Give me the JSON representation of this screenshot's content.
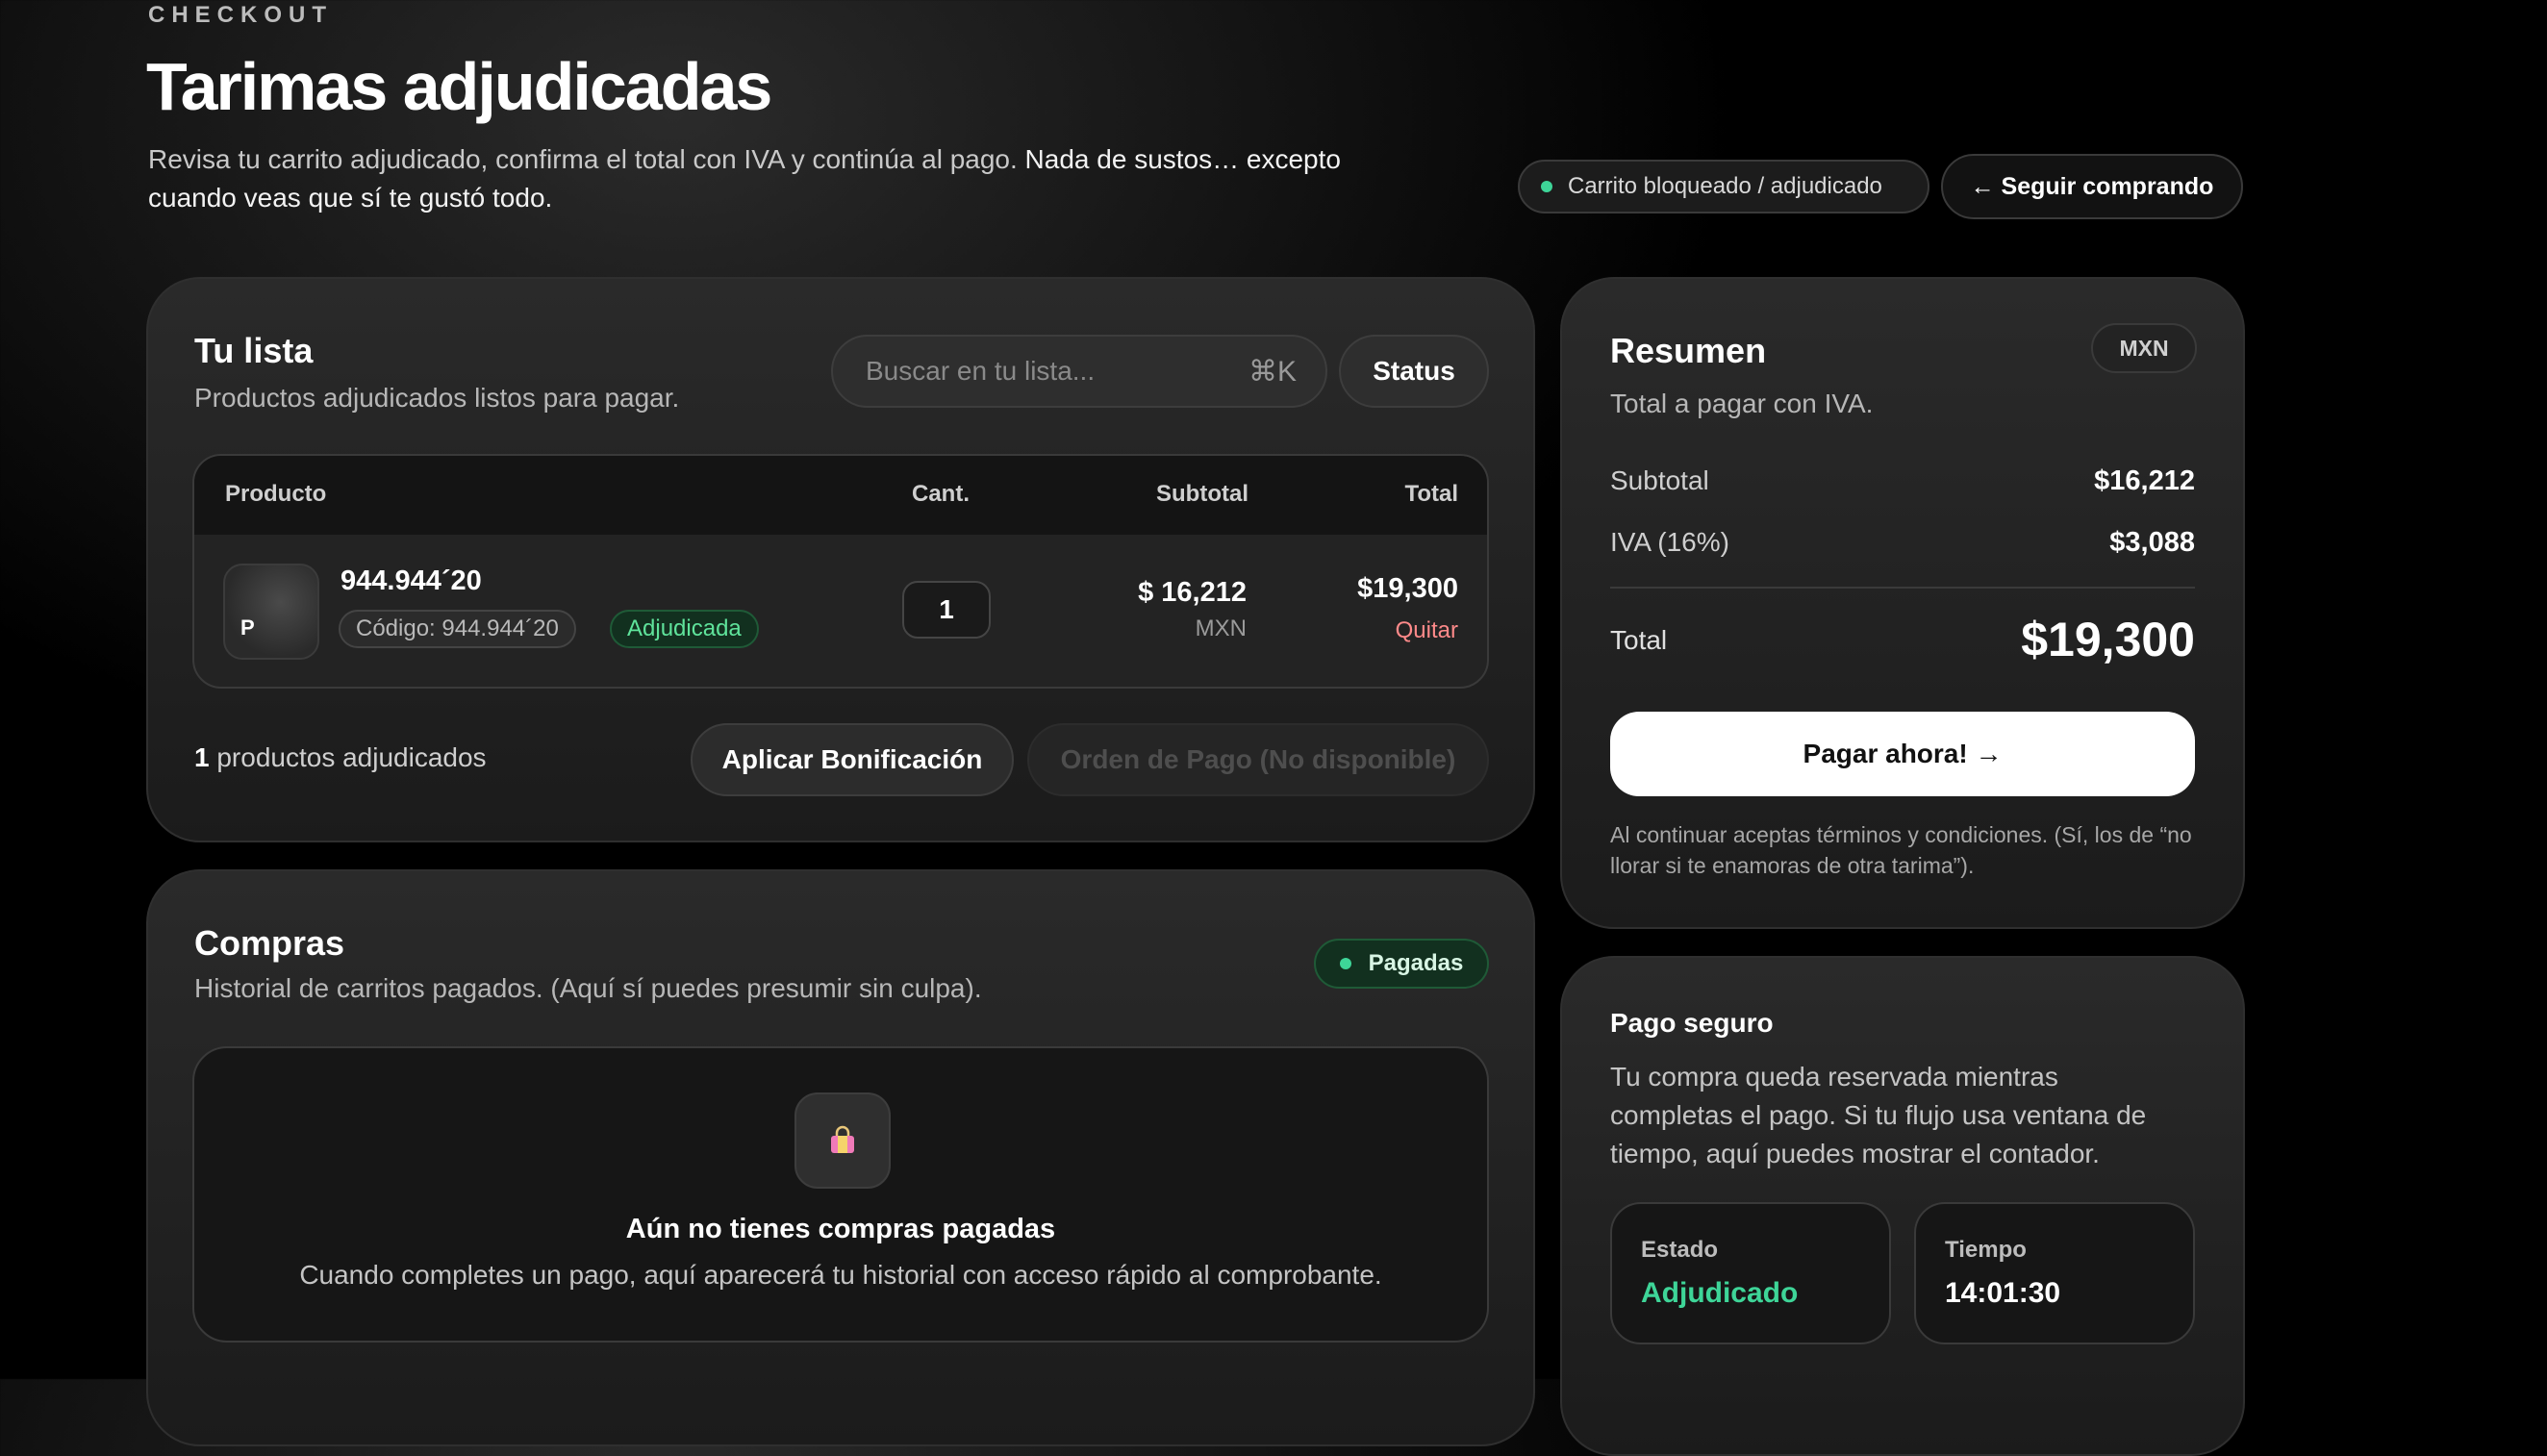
{
  "header": {
    "eyebrow": "CHECKOUT",
    "title": "Tarimas adjudicadas",
    "subtitle_main": "Revisa tu carrito adjudicado, confirma el total con IVA y continúa al pago. ",
    "subtitle_bold": "Nada de sustos… excepto cuando veas que sí te gustó todo.",
    "status_pill": "Carrito bloqueado / adjudicado",
    "seguir_button": "← Seguir comprando"
  },
  "lista": {
    "title": "Tu lista",
    "subtitle": "Productos adjudicados listos para pagar.",
    "search_placeholder": "Buscar en tu lista...",
    "search_shortcut": "⌘K",
    "status_button": "Status",
    "columns": {
      "producto": "Producto",
      "cant": "Cant.",
      "subtotal": "Subtotal",
      "total": "Total"
    },
    "row": {
      "thumb_letter": "P",
      "name": "944.944´20",
      "code": "Código: 944.944´20",
      "badge": "Adjudicada",
      "qty": "1",
      "subtotal": "$ 16,212",
      "currency": "MXN",
      "total": "$19,300",
      "remove": "Quitar"
    },
    "count": "1",
    "count_label": " productos adjudicados",
    "bonificacion_button": "Aplicar Bonificación",
    "orden_button": "Orden de Pago (No disponible)"
  },
  "compras": {
    "title": "Compras",
    "subtitle": "Historial de carritos pagados. (Aquí sí puedes presumir sin culpa).",
    "badge": "Pagadas",
    "empty_title": "Aún no tienes compras pagadas",
    "empty_text": "Cuando completes un pago, aquí aparecerá tu historial con acceso rápido al comprobante.",
    "empty_icon": "shopping-bag-icon"
  },
  "resumen": {
    "title": "Resumen",
    "currency_badge": "MXN",
    "subtitle": "Total a pagar con IVA.",
    "subtotal_label": "Subtotal",
    "subtotal_value": "$16,212",
    "iva_label": "IVA (16%)",
    "iva_value": "$3,088",
    "total_label": "Total",
    "total_value": "$19,300",
    "pay_button": "Pagar ahora! →",
    "terms": "Al continuar aceptas términos y condiciones. (Sí, los de “no llorar si te enamoras de otra tarima”)."
  },
  "pago": {
    "title": "Pago seguro",
    "text": "Tu compra queda reservada mientras completas el pago. Si tu flujo usa ventana de tiempo, aquí puedes mostrar el contador.",
    "estado_label": "Estado",
    "estado_value": "Adjudicado",
    "tiempo_label": "Tiempo",
    "tiempo_value": "14:01:30"
  },
  "colors": {
    "accent_green": "#3ed598",
    "remove_red": "#ff8a8a"
  }
}
